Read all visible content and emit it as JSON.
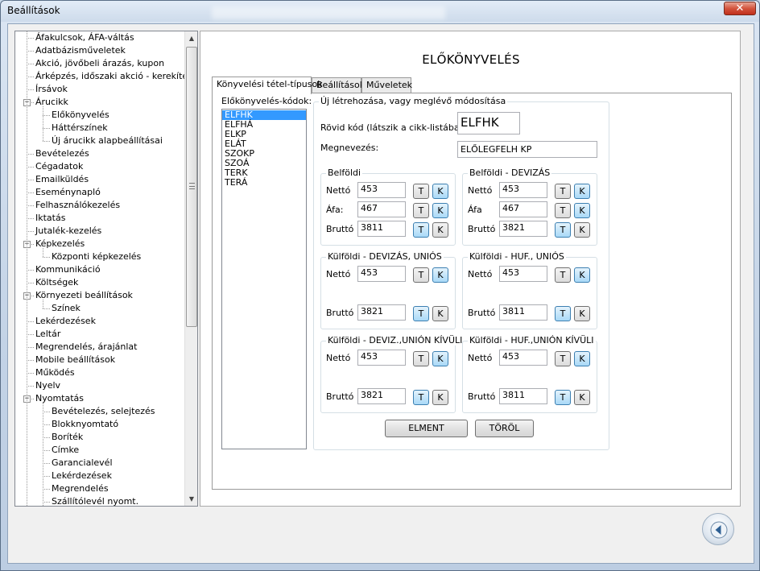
{
  "window": {
    "title": "Beállítások",
    "close_label": "✕"
  },
  "tree": {
    "items": [
      {
        "label": "Áfakulcsok, ÁFA-váltás",
        "level": 0
      },
      {
        "label": "Adatbázisműveletek",
        "level": 0
      },
      {
        "label": "Akció, jövőbeli árazás, kupon",
        "level": 0
      },
      {
        "label": "Árképzés, időszaki akció - kerekítés",
        "level": 0
      },
      {
        "label": "Írsávok",
        "level": 0
      },
      {
        "label": "Árucikk",
        "level": 0,
        "expanded": true
      },
      {
        "label": "Előkönyvelés",
        "level": 1
      },
      {
        "label": "Háttérszínek",
        "level": 1
      },
      {
        "label": "Új árucikk alapbeállításai",
        "level": 1
      },
      {
        "label": "Bevételezés",
        "level": 0
      },
      {
        "label": "Cégadatok",
        "level": 0
      },
      {
        "label": "Emailküldés",
        "level": 0
      },
      {
        "label": "Eseménynapló",
        "level": 0
      },
      {
        "label": "Felhasználókezelés",
        "level": 0
      },
      {
        "label": "Iktatás",
        "level": 0
      },
      {
        "label": "Jutalék-kezelés",
        "level": 0
      },
      {
        "label": "Képkezelés",
        "level": 0,
        "expanded": true
      },
      {
        "label": "Központi képkezelés",
        "level": 1
      },
      {
        "label": "Kommunikáció",
        "level": 0
      },
      {
        "label": "Költségek",
        "level": 0
      },
      {
        "label": "Környezeti beállítások",
        "level": 0,
        "expanded": true
      },
      {
        "label": "Színek",
        "level": 1
      },
      {
        "label": "Lekérdezések",
        "level": 0
      },
      {
        "label": "Leltár",
        "level": 0
      },
      {
        "label": "Megrendelés, árajánlat",
        "level": 0
      },
      {
        "label": "Mobile beállítások",
        "level": 0
      },
      {
        "label": "Működés",
        "level": 0
      },
      {
        "label": "Nyelv",
        "level": 0
      },
      {
        "label": "Nyomtatás",
        "level": 0,
        "expanded": true
      },
      {
        "label": "Bevételezés, selejtezés",
        "level": 1
      },
      {
        "label": "Blokknyomtató",
        "level": 1
      },
      {
        "label": "Boríték",
        "level": 1
      },
      {
        "label": "Címke",
        "level": 1
      },
      {
        "label": "Garancialevél",
        "level": 1
      },
      {
        "label": "Lekérdezések",
        "level": 1
      },
      {
        "label": "Megrendelés",
        "level": 1
      },
      {
        "label": "Szállítólevél nyomt.",
        "level": 1
      }
    ]
  },
  "panel": {
    "title": "ELŐKÖNYVELÉS",
    "tabs": [
      "Könyvelési tétel-típusok",
      "Beállítások",
      "Műveletek"
    ],
    "codes_label": "Előkönyvelés-kódok:",
    "codes": [
      "ELFHK",
      "ELFHÁ",
      "ELKP",
      "ELÁT",
      "SZOKP",
      "SZOÁ",
      "TERK",
      "TERÁ"
    ],
    "form": {
      "group_label": "Új létrehozása, vagy meglévő módosítása",
      "short_code_label": "Rövid kód (látszik a cikk-listában):",
      "short_code_value": "ELFHK",
      "name_label": "Megnevezés:",
      "name_value": "ELŐLEGFELH KP",
      "t_label": "T",
      "k_label": "K",
      "groups": [
        {
          "title": "Belföldi",
          "rows": [
            {
              "label": "Nettó",
              "value": "453",
              "active": "K"
            },
            {
              "label": "Áfa:",
              "value": "467",
              "active": "K"
            },
            {
              "label": "Bruttó",
              "value": "3811",
              "active": "T"
            }
          ]
        },
        {
          "title": "Belföldi - DEVIZÁS",
          "rows": [
            {
              "label": "Nettó",
              "value": "453",
              "active": "K"
            },
            {
              "label": "Áfa",
              "value": "467",
              "active": "K"
            },
            {
              "label": "Bruttó",
              "value": "3821",
              "active": "T"
            }
          ]
        },
        {
          "title": "Külföldi - DEVIZÁS, UNIÓS",
          "rows": [
            {
              "label": "Nettó",
              "value": "453",
              "active": "K"
            },
            {
              "label": "Bruttó",
              "value": "3821",
              "active": "T"
            }
          ]
        },
        {
          "title": "Külföldi - HUF., UNIÓS",
          "rows": [
            {
              "label": "Nettó",
              "value": "453",
              "active": "K"
            },
            {
              "label": "Bruttó",
              "value": "3811",
              "active": "T"
            }
          ]
        },
        {
          "title": "Külföldi - DEVIZ.,UNIÓN KÍVÜLI",
          "rows": [
            {
              "label": "Nettó",
              "value": "453",
              "active": "K"
            },
            {
              "label": "Bruttó",
              "value": "3821",
              "active": "T"
            }
          ]
        },
        {
          "title": "Külföldi - HUF.,UNIÓN KÍVÜLI",
          "rows": [
            {
              "label": "Nettó",
              "value": "453",
              "active": "K"
            },
            {
              "label": "Bruttó",
              "value": "3811",
              "active": "T"
            }
          ]
        }
      ],
      "save_label": "ELMENT",
      "delete_label": "TÖRÖL"
    }
  },
  "colors": {
    "selection": "#3399ff",
    "toggle_active": "#a9d9f7"
  },
  "icons": {
    "back": "back-arrow-icon"
  }
}
